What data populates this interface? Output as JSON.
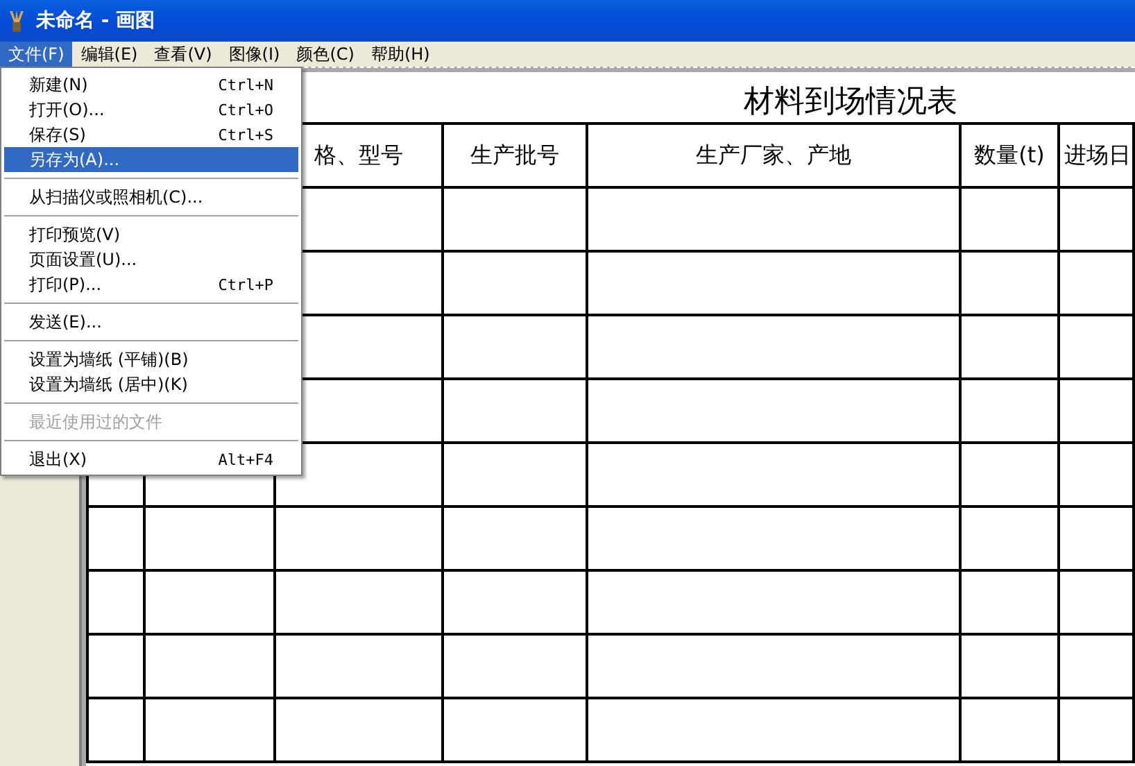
{
  "window": {
    "title": "未命名 - 画图"
  },
  "menu_bar": [
    {
      "label": "文件(F)",
      "selected": true
    },
    {
      "label": "编辑(E)",
      "selected": false
    },
    {
      "label": "查看(V)",
      "selected": false
    },
    {
      "label": "图像(I)",
      "selected": false
    },
    {
      "label": "颜色(C)",
      "selected": false
    },
    {
      "label": "帮助(H)",
      "selected": false
    }
  ],
  "file_menu": [
    {
      "kind": "item",
      "label": "新建(N)",
      "shortcut": "Ctrl+N",
      "selected": false,
      "disabled": false
    },
    {
      "kind": "item",
      "label": "打开(O)...",
      "shortcut": "Ctrl+O",
      "selected": false,
      "disabled": false
    },
    {
      "kind": "item",
      "label": "保存(S)",
      "shortcut": "Ctrl+S",
      "selected": false,
      "disabled": false
    },
    {
      "kind": "item",
      "label": "另存为(A)...",
      "selected": true,
      "disabled": false
    },
    {
      "kind": "separator"
    },
    {
      "kind": "item",
      "label": "从扫描仪或照相机(C)...",
      "selected": false,
      "disabled": false
    },
    {
      "kind": "separator"
    },
    {
      "kind": "item",
      "label": "打印预览(V)",
      "selected": false,
      "disabled": false
    },
    {
      "kind": "item",
      "label": "页面设置(U)...",
      "selected": false,
      "disabled": false
    },
    {
      "kind": "item",
      "label": "打印(P)...",
      "shortcut": "Ctrl+P",
      "selected": false,
      "disabled": false
    },
    {
      "kind": "separator"
    },
    {
      "kind": "item",
      "label": "发送(E)...",
      "selected": false,
      "disabled": false
    },
    {
      "kind": "separator"
    },
    {
      "kind": "item",
      "label": "设置为墙纸 (平铺)(B)",
      "selected": false,
      "disabled": false
    },
    {
      "kind": "item",
      "label": "设置为墙纸 (居中)(K)",
      "selected": false,
      "disabled": false
    },
    {
      "kind": "separator"
    },
    {
      "kind": "item",
      "label": "最近使用过的文件",
      "selected": false,
      "disabled": true
    },
    {
      "kind": "separator"
    },
    {
      "kind": "item",
      "label": "退出(X)",
      "shortcut": "Alt+F4",
      "selected": false,
      "disabled": false
    }
  ],
  "canvas": {
    "table": {
      "title": "材料到场情况表",
      "columns": [
        "",
        "",
        "格、型号",
        "生产批号",
        "生产厂家、产地",
        "数量(t)",
        "进场日"
      ]
    }
  }
}
